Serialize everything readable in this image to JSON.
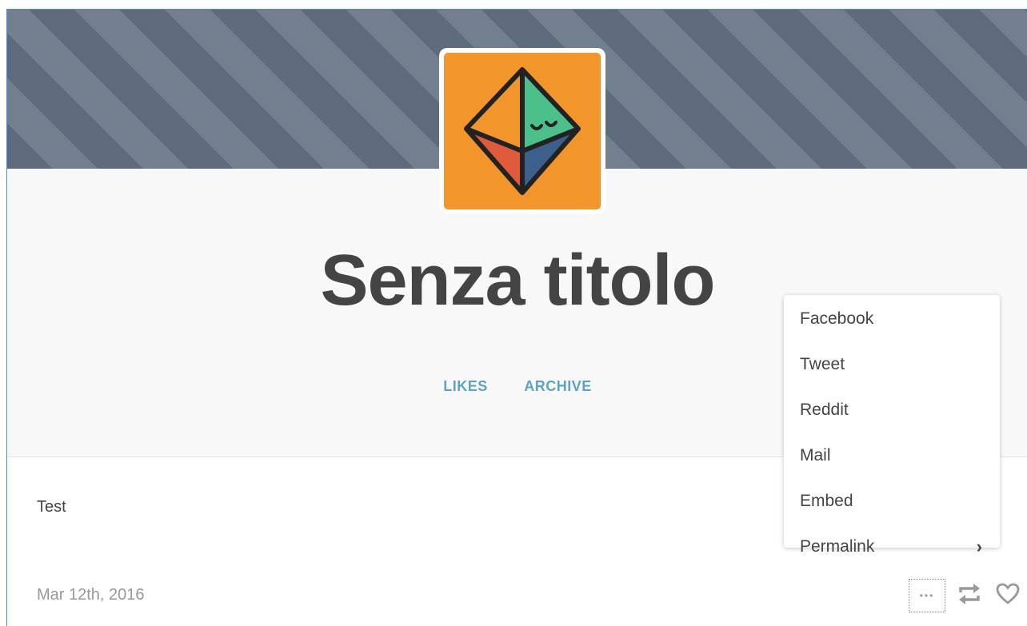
{
  "blog": {
    "title": "Senza titolo",
    "avatar_icon": "octahedron-face-icon"
  },
  "nav": {
    "likes": "LIKES",
    "archive": "ARCHIVE"
  },
  "post": {
    "text": "Test",
    "date": "Mar 12th, 2016"
  },
  "actions": {
    "more": "•••",
    "reblog_icon": "reblog-icon",
    "like_icon": "heart-icon"
  },
  "share_menu": {
    "items": [
      {
        "label": "Facebook"
      },
      {
        "label": "Tweet"
      },
      {
        "label": "Reddit"
      },
      {
        "label": "Mail"
      },
      {
        "label": "Embed"
      },
      {
        "label": "Permalink"
      }
    ],
    "permalink_chevron": "›"
  },
  "colors": {
    "avatar_bg": "#f2962b",
    "nav_link": "#5ca3c7",
    "title": "#444444"
  }
}
